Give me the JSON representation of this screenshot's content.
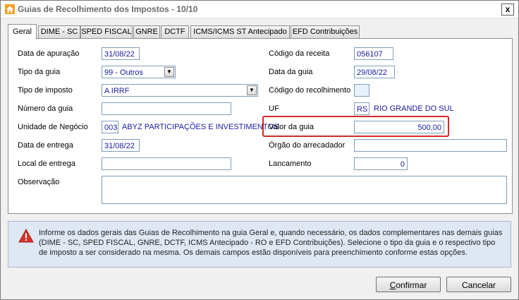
{
  "window": {
    "title": "Guias de Recolhimento dos Impostos - 10/10",
    "close_label": "x"
  },
  "tabs": [
    {
      "label": "Geral"
    },
    {
      "label": "DIME - SC"
    },
    {
      "label": "SPED FISCAL"
    },
    {
      "label": "GNRE"
    },
    {
      "label": "DCTF"
    },
    {
      "label": "ICMS/ICMS ST Antecipado"
    },
    {
      "label": "EFD Contribuições"
    }
  ],
  "form": {
    "data_apuracao": {
      "label": "Data de apuração",
      "value": "31/08/22"
    },
    "tipo_guia": {
      "label": "Tipo da guia",
      "value": "99 - Outros"
    },
    "tipo_imposto": {
      "label": "Tipo de imposto",
      "value": "A IRRF"
    },
    "numero_guia": {
      "label": "Número da guia",
      "value": ""
    },
    "unidade_negocio": {
      "label": "Unidade de Negócio",
      "code": "003",
      "name": "ABYZ PARTICIPAÇÕES E INVESTIMENTOS"
    },
    "data_entrega": {
      "label": "Data de entrega",
      "value": "31/08/22"
    },
    "local_entrega": {
      "label": "Local de entrega",
      "value": ""
    },
    "observacao": {
      "label": "Observação",
      "value": ""
    },
    "codigo_receita": {
      "label": "Código da receita",
      "value": "056107"
    },
    "data_guia": {
      "label": "Data da guia",
      "value": "29/08/22"
    },
    "codigo_recolhimento": {
      "label": "Código do recolhimento",
      "value": ""
    },
    "uf": {
      "label": "UF",
      "value": "RS",
      "name": "RIO GRANDE DO SUL"
    },
    "valor_guia": {
      "label": "Valor da guia",
      "value": "500,00"
    },
    "orgao_arrecadador": {
      "label": "Órgão do arrecadador",
      "value": ""
    },
    "lancamento": {
      "label": "Lancamento",
      "value": "0"
    }
  },
  "info": {
    "text": "Informe os dados gerais das Guias de Recolhimento na guia Geral e, quando necessário, os dados complementares nas demais guias (DIME - SC, SPED FISCAL, GNRE, DCTF, ICMS Antecipado - RO e EFD Contribuições). Selecione o tipo da guia e o respectivo tipo de imposto a ser considerado na mesma. Os demais campos estão disponíveis para preenchimento conforme estas opções."
  },
  "buttons": {
    "confirm_first": "C",
    "confirm_rest": "onfirmar",
    "cancel": "Cancelar"
  },
  "colors": {
    "highlight": "#d42a2a",
    "value_text": "#1a1aa0",
    "info_bg": "#dfe7f3"
  },
  "icons": {
    "app": "house-icon",
    "warning": "warning-triangle-icon",
    "combo": "chevron-down-icon"
  }
}
